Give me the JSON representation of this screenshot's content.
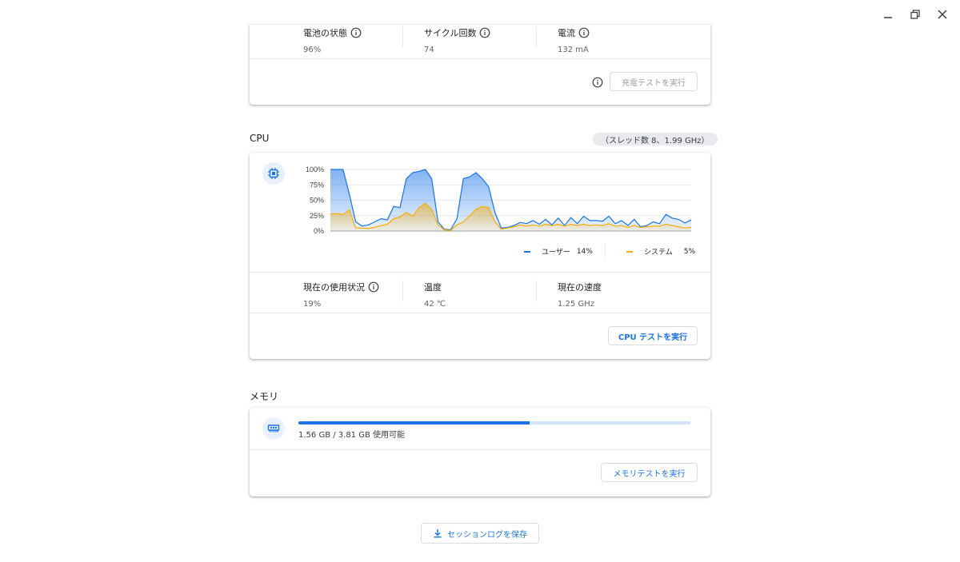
{
  "window": {
    "controls": [
      {
        "name": "minimize-button",
        "icon": "minimize-icon"
      },
      {
        "name": "maximize-button",
        "icon": "maximize-icon"
      },
      {
        "name": "close-button",
        "icon": "close-icon"
      }
    ]
  },
  "battery": {
    "health_label": "電池の状態",
    "health_value": "96%",
    "cycle_label": "サイクル回数",
    "cycle_value": "74",
    "current_label": "電流",
    "current_value": "132 mA",
    "run_test_label": "充電テストを実行"
  },
  "cpu": {
    "section_title": "CPU",
    "info_chip": "（スレッド数 8、1.99 GHz）",
    "icon": "cpu-chip-icon",
    "usage_label": "現在の使用状況",
    "usage_value": "19%",
    "temp_label": "温度",
    "temp_value": "42 ℃",
    "speed_label": "現在の速度",
    "speed_value": "1.25 GHz",
    "run_test_label": "CPU テストを実行",
    "legend": {
      "user_label": "ユーザー",
      "user_value": "14%",
      "system_label": "システム",
      "system_value": "5%"
    }
  },
  "memory": {
    "section_title": "メモリ",
    "icon": "memory-module-icon",
    "usage_text": "1.56 GB / 3.81 GB 使用可能",
    "used_fraction": 0.5906,
    "run_test_label": "メモリテストを実行"
  },
  "footer": {
    "save_log_label": "セッションログを保存",
    "save_icon": "download-icon"
  },
  "colors": {
    "accent": "#1a73e8",
    "user_series": "#1a73e8",
    "system_series": "#f9ab00"
  },
  "chart_data": {
    "type": "area",
    "title": "",
    "xlabel": "",
    "ylabel": "",
    "ylim": [
      0,
      100
    ],
    "yticks": [
      "100%",
      "75%",
      "50%",
      "25%",
      "0%"
    ],
    "grid": true,
    "legend_position": "bottom-right",
    "series": [
      {
        "name": "ユーザー",
        "color": "#1a73e8",
        "values": [
          100,
          100,
          100,
          60,
          15,
          8,
          10,
          15,
          20,
          18,
          40,
          38,
          85,
          95,
          97,
          100,
          85,
          15,
          3,
          2,
          20,
          85,
          88,
          95,
          85,
          72,
          30,
          5,
          6,
          9,
          14,
          12,
          17,
          11,
          19,
          10,
          21,
          9,
          22,
          12,
          24,
          17,
          17,
          16,
          24,
          12,
          17,
          9,
          19,
          7,
          9,
          15,
          12,
          27,
          21,
          19,
          13,
          18
        ]
      },
      {
        "name": "システム",
        "color": "#f9ab00",
        "values": [
          28,
          28,
          27,
          34,
          5,
          5,
          4,
          6,
          9,
          11,
          20,
          23,
          30,
          24,
          38,
          45,
          35,
          10,
          2,
          1,
          10,
          15,
          25,
          35,
          40,
          38,
          15,
          3,
          5,
          7,
          10,
          8,
          10,
          8,
          11,
          9,
          11,
          8,
          11,
          9,
          11,
          9,
          10,
          9,
          12,
          8,
          9,
          6,
          9,
          6,
          7,
          8,
          8,
          11,
          9,
          7,
          5,
          6
        ]
      }
    ]
  }
}
